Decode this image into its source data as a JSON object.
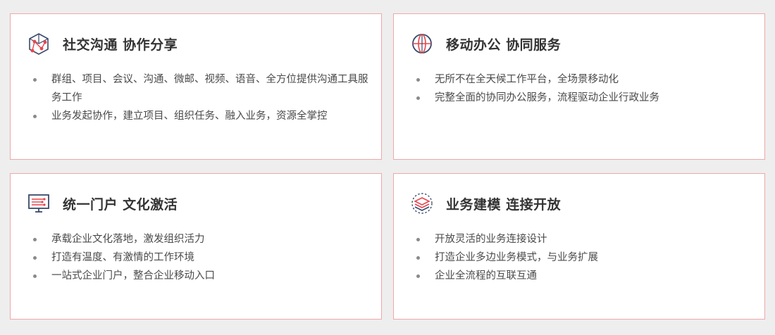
{
  "colors": {
    "background": "#eeeeee",
    "card_border": "#f0a7aa",
    "icon_dark": "#3a4a6b",
    "icon_accent": "#e8464c"
  },
  "cards": [
    {
      "icon": "cube-network-icon",
      "title": "社交沟通 协作分享",
      "items": [
        "群组、项目、会议、沟通、微邮、视频、语音、全方位提供沟通工具服务工作",
        "业务发起协作，建立项目、组织任务、融入业务，资源全掌控"
      ]
    },
    {
      "icon": "globe-icon",
      "title": "移动办公 协同服务",
      "items": [
        "无所不在全天候工作平台，全场景移动化",
        "完整全面的协同办公服务，流程驱动企业行政业务"
      ]
    },
    {
      "icon": "monitor-icon",
      "title": "统一门户 文化激活",
      "items": [
        "承载企业文化落地，激发组织活力",
        "打造有温度、有激情的工作环境",
        "一站式企业门户，整合企业移动入口"
      ]
    },
    {
      "icon": "layers-icon",
      "title": "业务建模 连接开放",
      "items": [
        "开放灵活的业务连接设计",
        "打造企业多边业务模式，与业务扩展",
        "企业全流程的互联互通"
      ]
    }
  ]
}
